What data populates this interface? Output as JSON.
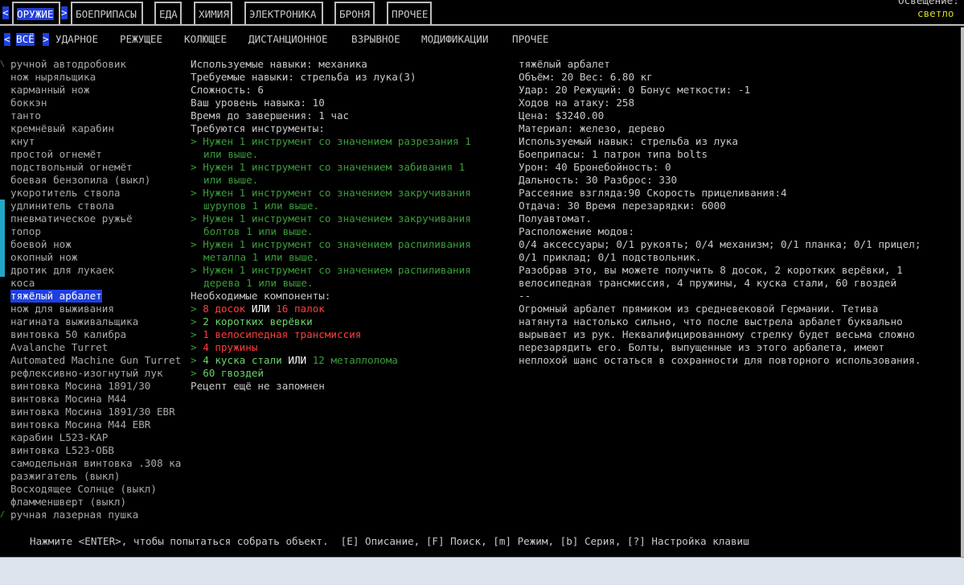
{
  "top_tabs": [
    {
      "label": "ОРУЖИЕ",
      "active": true
    },
    {
      "label": "БОЕПРИПАСЫ",
      "active": false
    },
    {
      "label": "ЕДА",
      "active": false
    },
    {
      "label": "ХИМИЯ",
      "active": false
    },
    {
      "label": "ЭЛЕКТРОНИКА",
      "active": false
    },
    {
      "label": "БРОНЯ",
      "active": false
    },
    {
      "label": "ПРОЧЕЕ",
      "active": false
    }
  ],
  "arrows": {
    "left": "<",
    "right": ">"
  },
  "lighting": {
    "label": "Освещение:",
    "value": "светло"
  },
  "sub_tabs": [
    "ВСЁ",
    "УДАРНОЕ",
    "РЕЖУЩЕЕ",
    "КОЛЮЩЕЕ",
    "ДИСТАНЦИОННОЕ",
    "ВЗРЫВНОЕ",
    "МОДИФИКАЦИИ",
    "ПРОЧЕЕ"
  ],
  "items": [
    "ручной автодробовик",
    "нож ныряльщика",
    "карманный нож",
    "боккэн",
    "танто",
    "кремнёвый карабин",
    "кнут",
    "простой огнемёт",
    "подствольный огнемёт",
    "боевая бензопила (выкл)",
    "укоротитель ствола",
    "удлинитель ствола",
    "пневматическое ружьё",
    "топор",
    "боевой нож",
    "окопный нож",
    "дротик для лукаек",
    "коса",
    "тяжёлый арбалет",
    "нож для выживания",
    "нагината выживальщика",
    "винтовка 50 калибра",
    "Avalanche Turret",
    "Automated Machine Gun Turret",
    "рефлексивно-изогнутый лук",
    "винтовка Мосина 1891/30",
    "винтовка Мосина М44",
    "винтовка Мосина 1891/30 EBR",
    "винтовка Мосина М44 EBR",
    "карабин L523-КАР",
    "винтовка L523-ОБВ",
    "самодельная винтовка .308 ка",
    "разжигатель (выкл)",
    "Восходящее Солнце (выкл)",
    "фламменшверт (выкл)",
    "ручная лазерная пушка"
  ],
  "selected_index": 18,
  "recipe": {
    "used_skills": "Используемые навыки: механика",
    "required_skills": "Требуемые навыки: стрельба из лука(3)",
    "difficulty": "Сложность: 6",
    "your_level": "Ваш уровень навыка: 10",
    "time": "Время до завершения: 1 час",
    "tools_header": "Требуются инструменты:",
    "tools": [
      [
        "Нужен 1 инструмент со значением разрезания 1",
        "или выше."
      ],
      [
        "Нужен 1 инструмент со значением забивания 1",
        "или выше."
      ],
      [
        "Нужен 1 инструмент со значением закручивания",
        "шурупов 1 или выше."
      ],
      [
        "Нужен 1 инструмент со значением закручивания",
        "болтов 1 или выше."
      ],
      [
        "Нужен 1 инструмент со значением распиливания",
        "металла 1 или выше."
      ],
      [
        "Нужен 1 инструмент со значением распиливания",
        "дерева 1 или выше."
      ]
    ],
    "components_header": "Необходимые компоненты:",
    "bullet": ">",
    "or_word": "ИЛИ",
    "components": [
      {
        "a": "8 досок",
        "a_color": "red",
        "b": "16 палок",
        "b_color": "red"
      },
      {
        "a": "2 коротких верёвки",
        "a_color": "green"
      },
      {
        "a": "1 велосипедная трансмиссия",
        "a_color": "red"
      },
      {
        "a": "4 пружины",
        "a_color": "red"
      },
      {
        "a": "4 куска стали",
        "a_color": "green",
        "b": "12 металлолома",
        "b_color": "green"
      },
      {
        "a": "60 гвоздей",
        "a_color": "green"
      }
    ],
    "not_memorized": "Рецепт ещё не запомнен"
  },
  "details": [
    "тяжёлый арбалет",
    "Объём: 20 Вес: 6.80 кг",
    "Удар: 20 Режущий: 0 Бонус меткости: -1",
    "Ходов на атаку: 258",
    "Цена: $3240.00",
    "Материал: железо, дерево",
    "Используемый навык: стрельба из лука",
    "Боеприпасы: 1 патрон типа bolts",
    "Урон: 40 Бронебойность: 0",
    "Дальность: 30 Разброс: 330",
    "Рассеяние взгляда:90 Скорость прицеливания:4",
    "Отдача: 30 Время перезарядки: 6000",
    "Полуавтомат.",
    "Расположение модов:",
    "0/4 аксессуары; 0/1 рукоять; 0/4 механизм; 0/1 планка; 0/1 прицел;",
    "0/1 приклад; 0/1 подствольник.",
    "Разобрав это, вы можете получить 8 досок, 2 коротких верёвки, 1",
    "велосипедная трансмиссия, 4 пружины, 4 куска стали, 60 гвоздей",
    "--",
    "Огромный арбалет прямиком из средневековой Германии. Тетива",
    "натянута настолько сильно, что после выстрела арбалет буквально",
    "вырывает из рук. Неквалифицированному стрелку будет весьма сложно",
    "перезарядить его. Болты, выпущенные из этого арбалета, имеют",
    "неплохой шанс остаться в сохранности для повторного использования."
  ],
  "footer": "Нажмите <ENTER>, чтобы попытаться собрать объект.  [E] Описание, [F] Поиск, [m] Режим, [b] Серия, [?] Настройка клавиш"
}
